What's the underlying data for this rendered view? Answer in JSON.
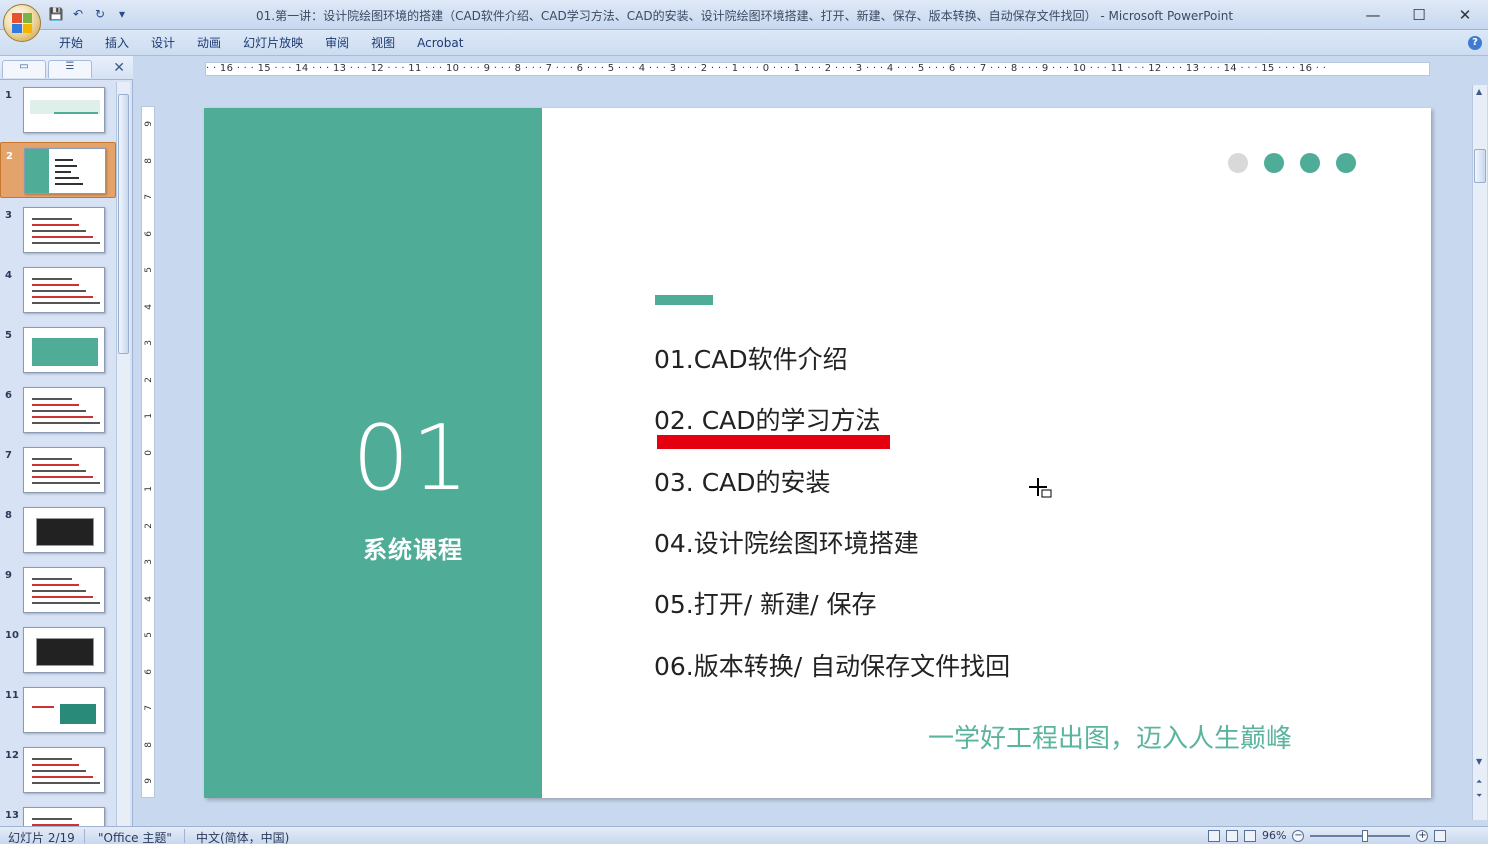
{
  "window": {
    "title": "01.第一讲：设计院绘图环境的搭建（CAD软件介绍、CAD学习方法、CAD的安装、设计院绘图环境搭建、打开、新建、保存、版本转换、自动保存文件找回） - Microsoft PowerPoint",
    "minimize": "—",
    "maximize": "☐",
    "close": "✕"
  },
  "qat": {
    "save": "💾",
    "undo": "↶",
    "redo": "↻",
    "more": "▾"
  },
  "ribbon": {
    "tabs": [
      "开始",
      "插入",
      "设计",
      "动画",
      "幻灯片放映",
      "审阅",
      "视图",
      "Acrobat"
    ],
    "help": "?"
  },
  "pane": {
    "tab_slides": "▭",
    "tab_outline": "☰",
    "close": "✕"
  },
  "thumbnails": [
    "1",
    "2",
    "3",
    "4",
    "5",
    "6",
    "7",
    "8",
    "9",
    "10",
    "11",
    "12",
    "13"
  ],
  "ruler": {
    "h": "· · 16 · · · 15 · · · 14 · · · 13 · · · 12 · · · 11 · · · 10 · · · 9 · · · 8 · · · 7 · · · 6 · · · 5 · · · 4 · · · 3 · · · 2 · · · 1 · · · 0 · · · 1 · · · 2 · · · 3 · · · 4 · · · 5 · · · 6 · · · 7 · · · 8 · · · 9 · · · 10 · · · 11 · · · 12 · · · 13 · · · 14 · · · 15 · · · 16 · ·",
    "v": [
      "9",
      "8",
      "7",
      "6",
      "5",
      "4",
      "3",
      "2",
      "1",
      "0",
      "1",
      "2",
      "3",
      "4",
      "5",
      "6",
      "7",
      "8",
      "9"
    ]
  },
  "slide": {
    "number": "01",
    "label": "系统课程",
    "dot_colors": [
      "#d9d9d9",
      "#4fac96",
      "#4fac96",
      "#4fac96"
    ],
    "accent_color": "#4fac96",
    "items": [
      "01.CAD软件介绍",
      "02. CAD的学习方法",
      "03. CAD的安装",
      "04.设计院绘图环境搭建",
      "05.打开/ 新建/ 保存",
      "06.版本转换/ 自动保存文件找回"
    ],
    "highlight_color": "#e4000f",
    "slogan": "一学好工程出图，迈入人生巅峰"
  },
  "status": {
    "slide_pos": "幻灯片 2/19",
    "theme": "\"Office 主题\"",
    "language": "中文(简体，中国)",
    "zoom": "96%",
    "zoom_level_percent": 96
  }
}
